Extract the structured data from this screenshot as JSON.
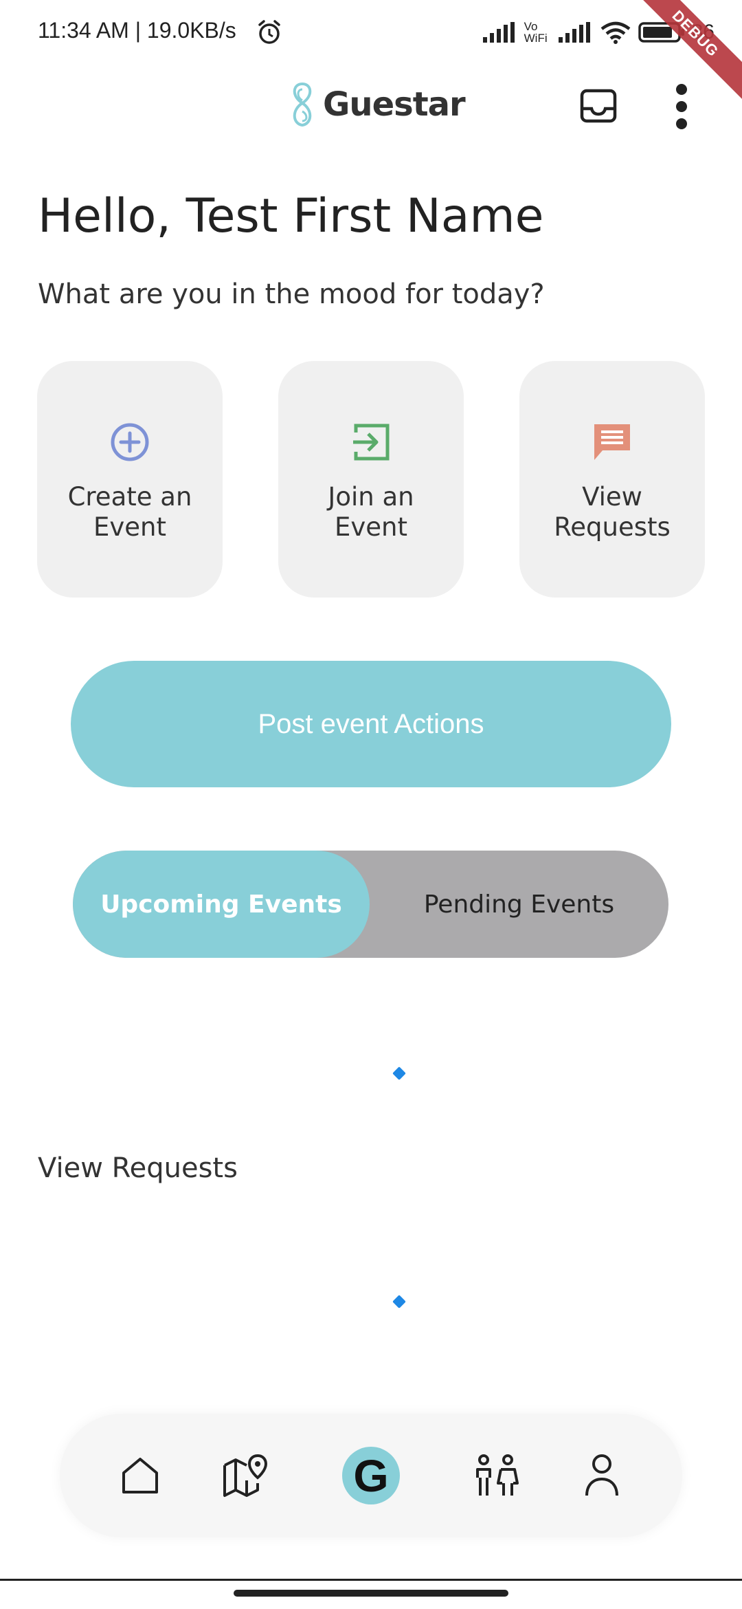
{
  "status_bar": {
    "time": "11:34 AM | 19.0KB/s",
    "network_label": "Vo WiFi",
    "battery": "86",
    "debug_banner": "DEBUG"
  },
  "app_bar": {
    "logo_text": "Guestar",
    "inbox_icon": "inbox-icon",
    "more_icon": "more-vert-icon"
  },
  "greeting": "Hello, Test First Name",
  "subtitle": "What are you in the mood for today?",
  "actions": [
    {
      "label": "Create an\nEvent",
      "icon": "add-circle-icon",
      "color": "#7e92d6"
    },
    {
      "label": "Join an\nEvent",
      "icon": "login-icon",
      "color": "#5aab6a"
    },
    {
      "label": "View\nRequests",
      "icon": "chat-icon",
      "color": "#e3907a"
    }
  ],
  "post_event_button": "Post event Actions",
  "tabs": {
    "upcoming": "Upcoming Events",
    "pending": "Pending Events",
    "selected": "upcoming"
  },
  "view_requests_title": "View Requests",
  "bottom_nav": [
    {
      "icon": "home-icon"
    },
    {
      "icon": "map-pin-icon"
    },
    {
      "icon": "guestar-g-icon",
      "label": "G"
    },
    {
      "icon": "people-icon"
    },
    {
      "icon": "profile-icon"
    }
  ],
  "colors": {
    "accent": "#88cfd8",
    "segment_bg": "#abaaac",
    "card_bg": "#f0f0f0",
    "spinner": "#1e88e5"
  }
}
